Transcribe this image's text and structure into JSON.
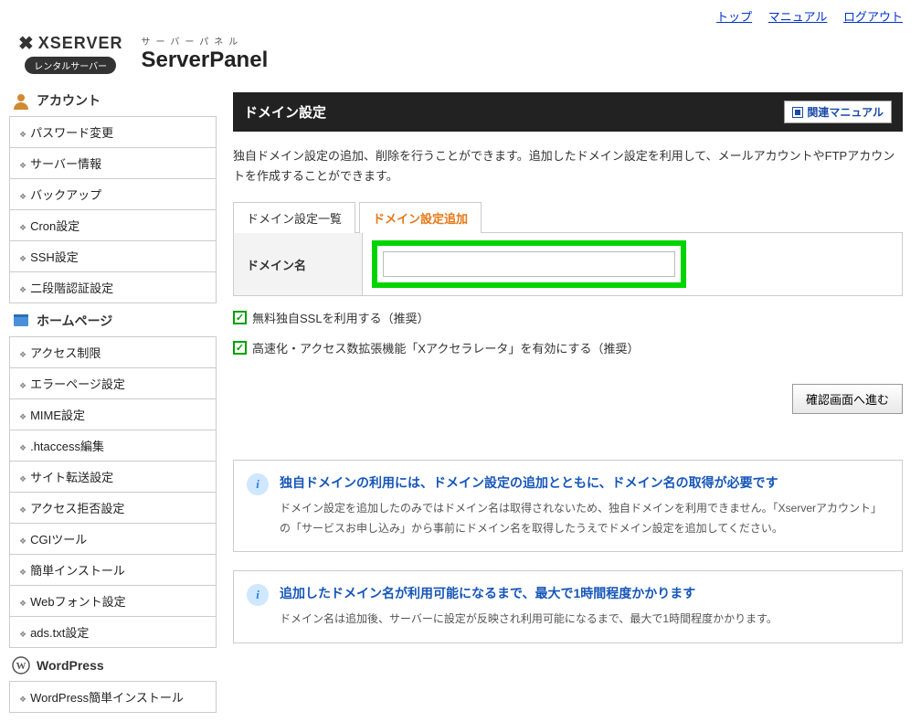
{
  "topnav": {
    "top": "トップ",
    "manual": "マニュアル",
    "logout": "ログアウト"
  },
  "brand": {
    "logo": "XSERVER",
    "rental": "レンタルサーバー",
    "panel_sub": "サーバーパネル",
    "panel_title": "ServerPanel"
  },
  "sidebar": {
    "account_title": "アカウント",
    "account_items": [
      "パスワード変更",
      "サーバー情報",
      "バックアップ",
      "Cron設定",
      "SSH設定",
      "二段階認証設定"
    ],
    "homepage_title": "ホームページ",
    "homepage_items": [
      "アクセス制限",
      "エラーページ設定",
      "MIME設定",
      ".htaccess編集",
      "サイト転送設定",
      "アクセス拒否設定",
      "CGIツール",
      "簡単インストール",
      "Webフォント設定",
      "ads.txt設定"
    ],
    "wordpress_title": "WordPress",
    "wordpress_items": [
      "WordPress簡単インストール"
    ]
  },
  "page": {
    "title": "ドメイン設定",
    "manual_btn": "関連マニュアル",
    "description": "独自ドメイン設定の追加、削除を行うことができます。追加したドメイン設定を利用して、メールアカウントやFTPアカウントを作成することができます。",
    "tabs": {
      "list": "ドメイン設定一覧",
      "add": "ドメイン設定追加"
    },
    "form": {
      "domain_label": "ドメイン名",
      "domain_value": ""
    },
    "chk1": "無料独自SSLを利用する（推奨）",
    "chk2": "高速化・アクセス数拡張機能「Xアクセラレータ」を有効にする（推奨）",
    "confirm": "確認画面へ進む",
    "info1_title": "独自ドメインの利用には、ドメイン設定の追加とともに、ドメイン名の取得が必要です",
    "info1_body": "ドメイン設定を追加したのみではドメイン名は取得されないため、独自ドメインを利用できません。「Xserverアカウント」の「サービスお申し込み」から事前にドメイン名を取得したうえでドメイン設定を追加してください。",
    "info2_title": "追加したドメイン名が利用可能になるまで、最大で1時間程度かかります",
    "info2_body": "ドメイン名は追加後、サーバーに設定が反映され利用可能になるまで、最大で1時間程度かかります。"
  }
}
